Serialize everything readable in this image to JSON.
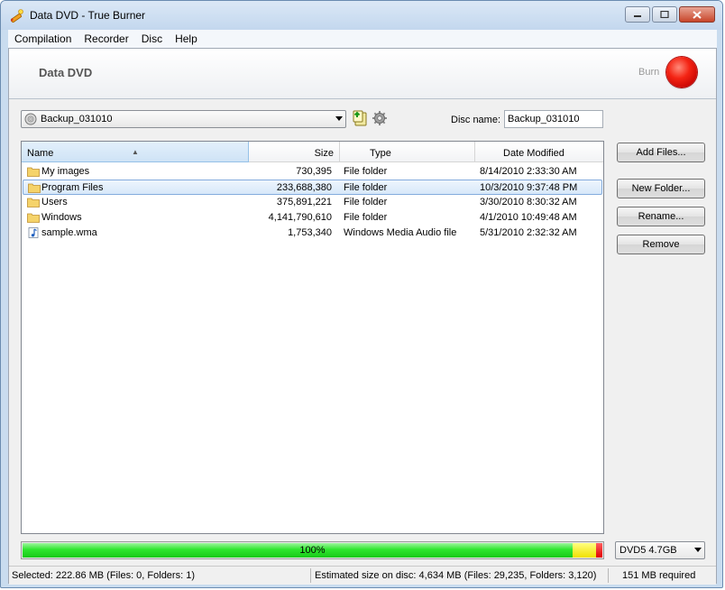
{
  "window": {
    "title": "Data DVD - True Burner"
  },
  "menu": [
    {
      "label": "Compilation"
    },
    {
      "label": "Recorder"
    },
    {
      "label": "Disc"
    },
    {
      "label": "Help"
    }
  ],
  "header": {
    "title": "Data DVD",
    "burn_label": "Burn"
  },
  "toolbar": {
    "compilation_value": "Backup_031010",
    "disc_name_label": "Disc name:",
    "disc_name_value": "Backup_031010"
  },
  "filelist": {
    "columns": {
      "name": "Name",
      "size": "Size",
      "type": "Type",
      "date": "Date Modified"
    },
    "rows": [
      {
        "name": "My images",
        "size": "730,395",
        "type": "File folder",
        "date": "8/14/2010 2:33:30 AM",
        "icon": "folder-icon",
        "selected": false
      },
      {
        "name": "Program Files",
        "size": "233,688,380",
        "type": "File folder",
        "date": "10/3/2010 9:37:48 PM",
        "icon": "folder-icon",
        "selected": true
      },
      {
        "name": "Users",
        "size": "375,891,221",
        "type": "File folder",
        "date": "3/30/2010 8:30:32 AM",
        "icon": "folder-icon",
        "selected": false
      },
      {
        "name": "Windows",
        "size": "4,141,790,610",
        "type": "File folder",
        "date": "4/1/2010 10:49:48 AM",
        "icon": "folder-icon",
        "selected": false
      },
      {
        "name": "sample.wma",
        "size": "1,753,340",
        "type": "Windows Media Audio file",
        "date": "5/31/2010 2:32:32 AM",
        "icon": "audio-file-icon",
        "selected": false
      }
    ]
  },
  "buttons": {
    "add_files": "Add Files...",
    "new_folder": "New Folder...",
    "rename": "Rename...",
    "remove": "Remove"
  },
  "progress": {
    "label": "100%",
    "fill_fraction": 1.0
  },
  "media": {
    "selected": "DVD5 4.7GB"
  },
  "status": {
    "selected": "Selected: 222.86 MB (Files: 0, Folders: 1)",
    "estimated": "Estimated size on disc: 4,634 MB (Files: 29,235, Folders: 3,120)",
    "required": "151 MB required"
  },
  "colors": {
    "burn_button": "#e81010",
    "progress_green": "#22dd22",
    "selection": "#d7e8f9"
  }
}
